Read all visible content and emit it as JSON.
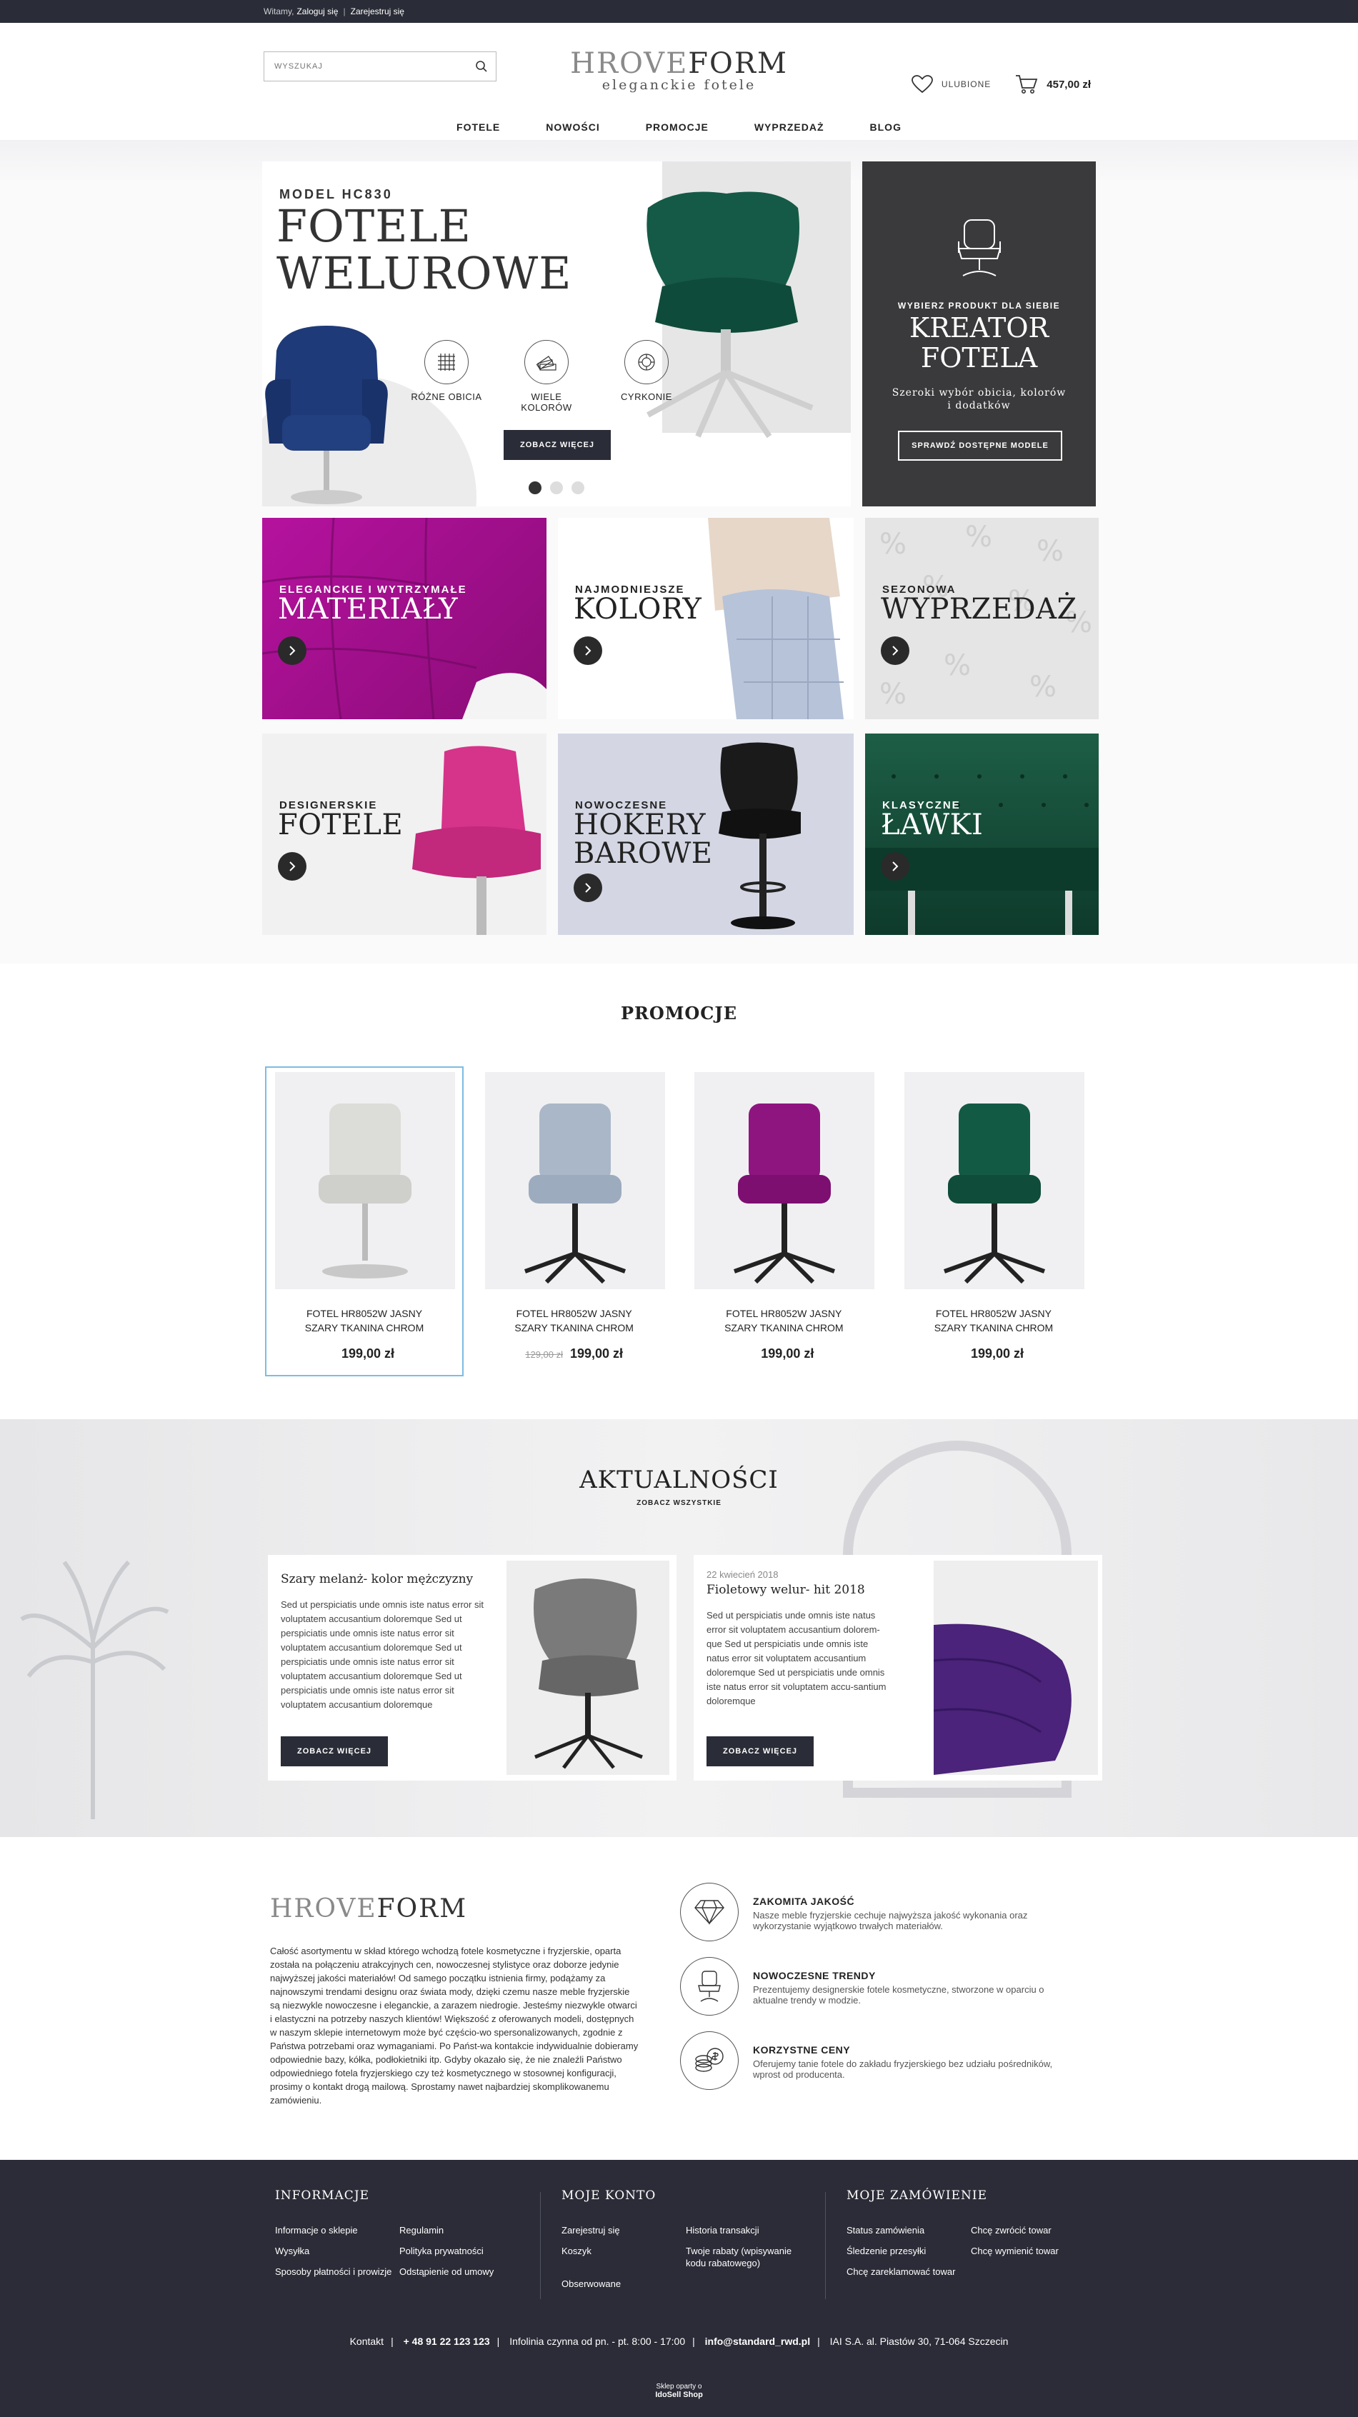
{
  "topbar": {
    "greeting": "Witamy,",
    "login": "Zaloguj się",
    "sep": "|",
    "register": "Zarejestruj się"
  },
  "header": {
    "search_placeholder": "WYSZUKAJ",
    "logo_light": "HROVE",
    "logo_dark": "FORM",
    "tagline": "eleganckie fotele",
    "favorites": "ULUBIONE",
    "cart_total": "457,00 zł"
  },
  "nav": [
    "FOTELE",
    "NOWOŚCI",
    "PROMOCJE",
    "WYPRZEDAŻ",
    "BLOG"
  ],
  "hero": {
    "model": "MODEL HC830",
    "title_line1": "FOTELE",
    "title_line2": "WELUROWE",
    "features": [
      "RÓŻNE OBICIA",
      "WIELE KOLORÓW",
      "CYRKONIE"
    ],
    "cta": "ZOBACZ WIĘCEJ",
    "slide_count": 3,
    "active_slide": 1
  },
  "creator": {
    "kicker": "WYBIERZ PRODUKT DLA SIEBIE",
    "title_line1": "KREATOR",
    "title_line2": "FOTELA",
    "subtitle": "Szeroki wybór obicia, kolorów i dodatków",
    "button": "SPRAWDŹ DOSTĘPNE MODELE"
  },
  "tiles": [
    {
      "kicker": "ELEGANCKIE I WYTRZYMAŁE",
      "head": "MATERIAŁY"
    },
    {
      "kicker": "NAJMODNIEJSZE",
      "head": "KOLORY"
    },
    {
      "kicker": "SEZONOWA",
      "head": "WYPRZEDAŻ"
    },
    {
      "kicker": "DESIGNERSKIE",
      "head": "FOTELE"
    },
    {
      "kicker": "NOWOCZESNE",
      "head_line1": "HOKERY",
      "head_line2": "BAROWE"
    },
    {
      "kicker": "KLASYCZNE",
      "head": "ŁAWKI"
    }
  ],
  "promo": {
    "title": "PROMOCJE",
    "products": [
      {
        "name_line1": "FOTEL HR8052W JASNY",
        "name_line2": "SZARY TKANINA CHROM",
        "old_price": "",
        "price": "199,00 zł",
        "color": "#dcdcd8"
      },
      {
        "name_line1": "FOTEL HR8052W JASNY",
        "name_line2": "SZARY TKANINA CHROM",
        "old_price": "129,00 zł",
        "price": "199,00 zł",
        "color": "#aab7c8"
      },
      {
        "name_line1": "FOTEL HR8052W JASNY",
        "name_line2": "SZARY TKANINA CHROM",
        "old_price": "",
        "price": "199,00 zł",
        "color": "#8e1580"
      },
      {
        "name_line1": "FOTEL HR8052W JASNY",
        "name_line2": "SZARY TKANINA CHROM",
        "old_price": "",
        "price": "199,00 zł",
        "color": "#135a45"
      }
    ]
  },
  "news": {
    "title": "AKTUALNOŚCI",
    "see_all": "ZOBACZ WSZYSTKIE",
    "items": [
      {
        "date": "",
        "title": "Szary melanż- kolor mężczyzny",
        "text": "Sed ut perspiciatis unde omnis iste natus error sit voluptatem accusantium doloremque Sed ut perspiciatis unde omnis iste natus error sit voluptatem accusantium doloremque Sed ut perspiciatis unde omnis iste natus error sit voluptatem accusantium doloremque Sed ut perspiciatis unde omnis iste natus error sit voluptatem accusantium doloremque",
        "button": "ZOBACZ WIĘCEJ"
      },
      {
        "date": "22 kwiecień 2018",
        "title": "Fioletowy welur- hit 2018",
        "text": "Sed ut perspiciatis unde omnis iste natus error sit voluptatem accusantium dolorem-que Sed ut perspiciatis unde omnis iste natus error sit voluptatem accusantium doloremque Sed ut perspiciatis unde omnis iste natus error sit voluptatem accu-santium doloremque",
        "button": "ZOBACZ WIĘCEJ"
      }
    ]
  },
  "about": {
    "logo_light": "HROVE",
    "logo_dark": "FORM",
    "description": "Całość asortymentu w skład którego wchodzą fotele kosmetyczne i fryzjerskie, oparta została na połączeniu atrakcyjnych cen, nowoczesnej stylistyce oraz doborze jedynie najwyższej jakości materiałów! Od samego początku istnienia firmy, podążamy za najnowszymi trendami designu oraz świata mody, dzięki czemu nasze meble fryzjerskie są niezwykle nowoczesne i eleganckie, a zarazem niedrogie. Jesteśmy niezwykle otwarci i elastyczni na potrzeby naszych klientów! Większość z oferowanych modeli, dostępnych w naszym sklepie internetowym może być częścio-wo spersonalizowanych, zgodnie z Państwa potrzebami oraz wymaganiami. Po Państ-wa kontakcie indywidualnie dobieramy odpowiednie bazy, kółka, podłokietniki itp. Gdyby okazało się, że nie znaleźli Państwo odpowiedniego fotela fryzjerskiego czy też kosmetycznego w stosownej konfiguracji, prosimy o kontakt drogą mailową. Sprostamy nawet najbardziej skomplikowanemu zamówieniu.",
    "features": [
      {
        "title": "ZAKOMITA JAKOŚĆ",
        "text": "Nasze meble fryzjerskie cechuje najwyższa jakość wykonania oraz wykorzystanie wyjątkowo trwałych materiałów.",
        "icon": "diamond-icon"
      },
      {
        "title": "NOWOCZESNE TRENDY",
        "text": "Prezentujemy designerskie fotele kosmetyczne, stworzone w oparciu o aktualne trendy w modzie.",
        "icon": "chair-icon"
      },
      {
        "title": "KORZYSTNE CENY",
        "text": "Oferujemy tanie fotele do zakładu fryzjerskiego bez udziału pośredników, wprost od producenta.",
        "icon": "coins-icon"
      }
    ]
  },
  "footer": {
    "columns": [
      {
        "title": "INFORMACJE",
        "links": [
          "Informacje o sklepie",
          "Regulamin",
          "Wysyłka",
          "Polityka prywatności",
          "Sposoby płatności i prowizje",
          "Odstąpienie od umowy"
        ]
      },
      {
        "title": "MOJE KONTO",
        "links": [
          "Zarejestruj się",
          "Historia transakcji",
          "Koszyk",
          "Twoje rabaty (wpisywanie kodu rabatowego)",
          "Obserwowane",
          ""
        ]
      },
      {
        "title": "MOJE ZAMÓWIENIE",
        "links": [
          "Status zamówienia",
          "Chcę zwrócić towar",
          "Śledzenie przesyłki",
          "Chcę wymienić towar",
          "Chcę zareklamować towar",
          ""
        ]
      }
    ],
    "contact_label": "Kontakt",
    "phone": "+ 48 91 22 123 123",
    "hours": "Infolinia czynna od pn. - pt. 8:00 - 17:00",
    "email": "info@standard_rwd.pl",
    "address": "IAI S.A. al. Piastów 30, 71-064 Szczecin",
    "powered_by": "Sklep oparty o",
    "powered_brand": "IdoSell Shop"
  }
}
